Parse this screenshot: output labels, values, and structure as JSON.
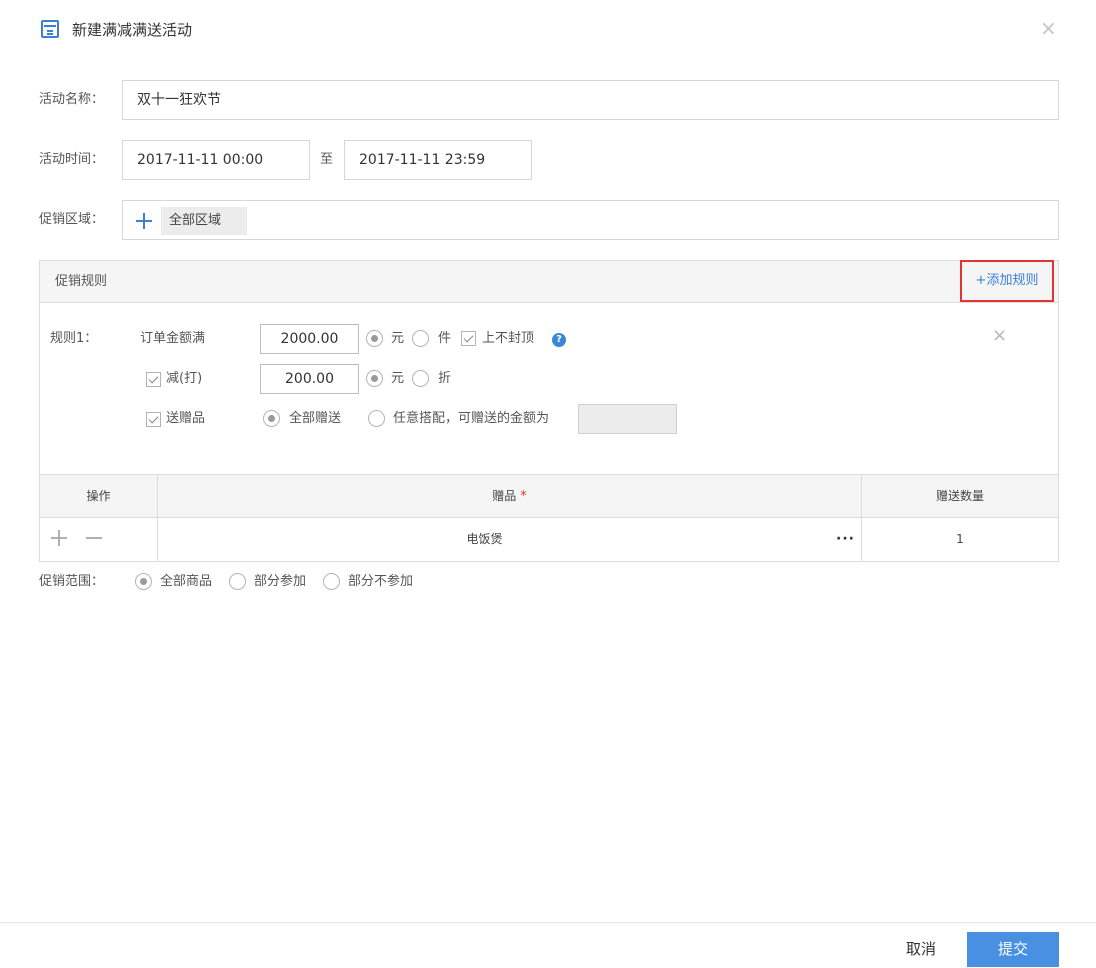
{
  "dialog": {
    "title": "新建满减满送活动",
    "close_icon": "close-icon",
    "title_icon": "form-icon"
  },
  "form": {
    "name_label": "活动名称：",
    "name_value": "双十一狂欢节",
    "time_label": "活动时间：",
    "start_time": "2017-11-11 00:00",
    "time_separator": "至",
    "end_time": "2017-11-11 23:59",
    "region_label": "促销区域：",
    "region_tag": "全部区域"
  },
  "rules": {
    "panel_title": "促销规则",
    "add_rule": "+添加规则",
    "rule_label": "规则1：",
    "threshold_label": "订单金额满",
    "threshold_value": "2000.00",
    "unit_yuan": "元",
    "unit_piece": "件",
    "no_cap_label": "上不封顶",
    "help_symbol": "?",
    "discount_label": "减(打)",
    "discount_value": "200.00",
    "discount_yuan": "元",
    "discount_zhe": "折",
    "gift_label": "送赠品",
    "gift_all": "全部赠送",
    "gift_any": "任意搭配，可赠送的金额为",
    "gift_amount": ""
  },
  "gift_table": {
    "columns": [
      "操作",
      "赠品",
      "赠送数量"
    ],
    "required_mark": "*",
    "rows": [
      {
        "gift": "电饭煲",
        "quantity": "1",
        "more": "···"
      }
    ]
  },
  "scope": {
    "label": "促销范围：",
    "options": [
      "全部商品",
      "部分参加",
      "部分不参加"
    ],
    "selected": 0
  },
  "footer": {
    "cancel": "取消",
    "submit": "提交"
  },
  "colors": {
    "accent": "#3a7fd6",
    "submit_bg": "#4a90e2",
    "highlight_border": "#e23434"
  }
}
